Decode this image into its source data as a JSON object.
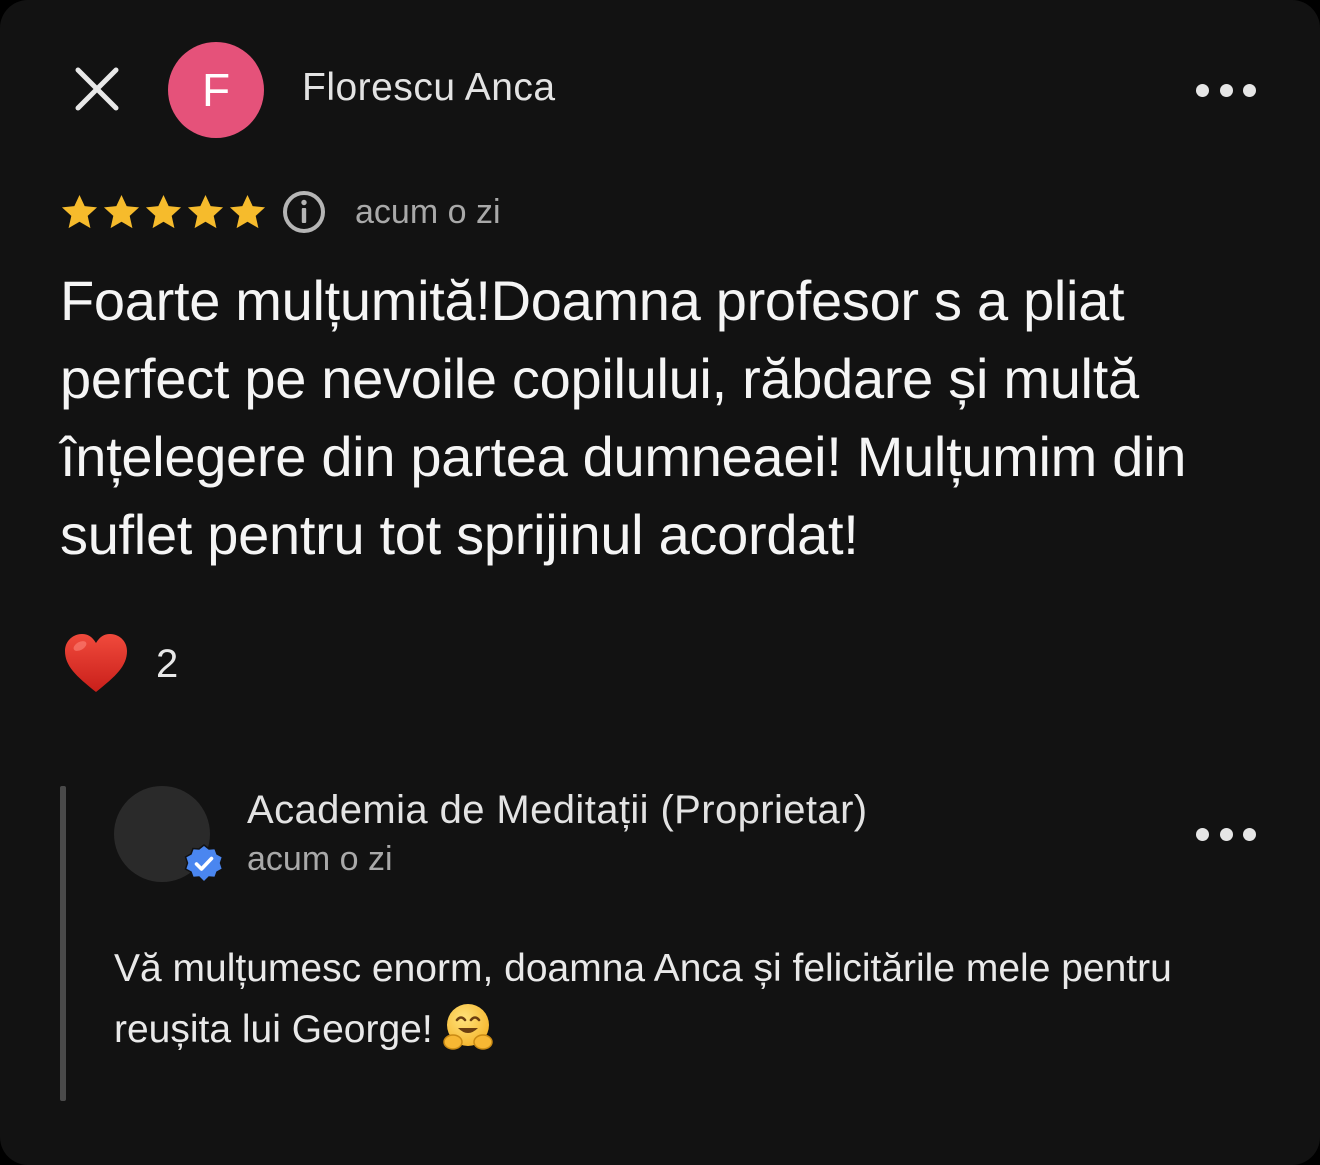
{
  "review": {
    "author_initial": "F",
    "author_name": "Florescu Anca",
    "rating": 5,
    "rating_max": 5,
    "time": "acum o zi",
    "text": "Foarte mulțumită!Doamna profesor s a pliat perfect pe nevoile copilului, răbdare și multă înțelegere din partea dumneaei! Mulțumim din suflet pentru tot sprijinul acordat!",
    "reaction_count": "2"
  },
  "reply": {
    "owner_name": "Academia de Meditații (Proprietar)",
    "time": "acum o zi",
    "text": "Vă mulțumesc enorm, doamna Anca și felicitările mele pentru reușita lui George!"
  },
  "icons": {
    "close": "close-icon",
    "more": "more-horizontal-icon",
    "star": "star-icon",
    "info": "info-icon",
    "reaction": "red-heart-icon",
    "verified": "verified-badge-icon",
    "emoji": "hugging-face-emoji"
  },
  "colors": {
    "background": "#121212",
    "avatar": "#e5527a",
    "star": "#f6bb2c",
    "verified": "#4a86f0",
    "heart": "#e0342c",
    "muted_text": "#a9a9a9"
  }
}
